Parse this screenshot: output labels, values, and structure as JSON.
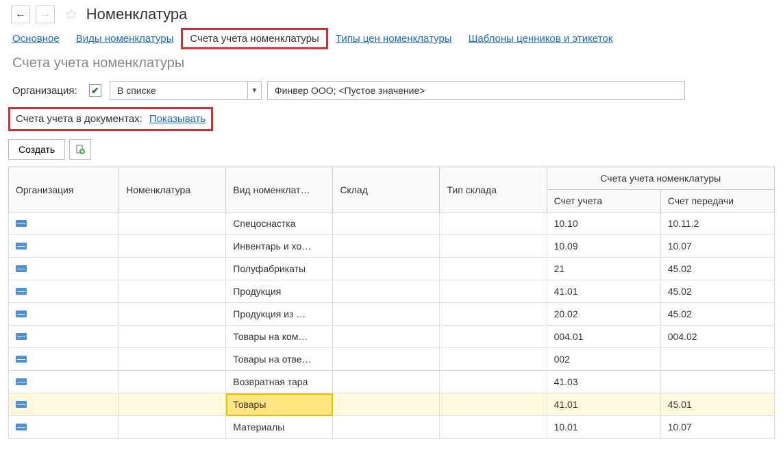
{
  "header": {
    "title": "Номенклатура"
  },
  "nav_links": [
    {
      "label": "Основное"
    },
    {
      "label": "Виды номенклатуры"
    },
    {
      "label": "Счета учета номенклатуры",
      "active": true
    },
    {
      "label": "Типы цен номенклатуры"
    },
    {
      "label": "Шаблоны ценников и этикеток"
    }
  ],
  "subtitle": "Счета учета номенклатуры",
  "filter": {
    "org_label": "Организация:",
    "checked": true,
    "mode": "В списке",
    "value": "Финвер ООО; <Пустое значение>"
  },
  "doc_row": {
    "label": "Счета учета в документах:",
    "link": "Показывать"
  },
  "toolbar": {
    "create_label": "Создать"
  },
  "table": {
    "headers": {
      "org": "Организация",
      "nomen": "Номенклатура",
      "vid": "Вид номенклат…",
      "sklad": "Склад",
      "tip": "Тип склада",
      "group": "Счета учета номенклатуры",
      "schet": "Счет учета",
      "per": "Счет передачи"
    },
    "rows": [
      {
        "vid": "Спецоснастка",
        "schet": "10.10",
        "per": "10.11.2"
      },
      {
        "vid": "Инвентарь и хо…",
        "schet": "10.09",
        "per": "10.07"
      },
      {
        "vid": "Полуфабрикаты",
        "schet": "21",
        "per": "45.02"
      },
      {
        "vid": "Продукция",
        "schet": "41.01",
        "per": "45.02"
      },
      {
        "vid": "Продукция из …",
        "schet": "20.02",
        "per": "45.02"
      },
      {
        "vid": "Товары на ком…",
        "schet": "004.01",
        "per": "004.02"
      },
      {
        "vid": "Товары на отве…",
        "schet": "002",
        "per": ""
      },
      {
        "vid": "Возвратная тара",
        "schet": "41.03",
        "per": ""
      },
      {
        "vid": "Товары",
        "schet": "41.01",
        "per": "45.01",
        "highlighted": true
      },
      {
        "vid": "Материалы",
        "schet": "10.01",
        "per": "10.07"
      }
    ]
  }
}
